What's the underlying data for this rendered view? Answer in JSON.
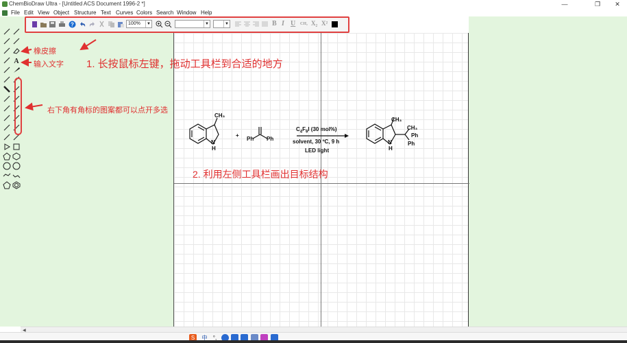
{
  "window": {
    "title": "ChemBioDraw Ultra - [Untitled ACS Document 1996-2 *]",
    "minimize_glyph": "—",
    "maximize_glyph": "❐",
    "close_glyph": "✕"
  },
  "menu": {
    "items": [
      "File",
      "Edit",
      "View",
      "Object",
      "Structure",
      "Text",
      "Curves",
      "Colors",
      "Search",
      "Window",
      "Help"
    ]
  },
  "toolbar": {
    "zoom_value": "100%",
    "font_value": "",
    "size_value": "",
    "bold_label": "B",
    "italic_label": "I",
    "underline_label": "U",
    "formula_label": "CH₂",
    "subscript_label": "X₂",
    "superscript_label": "X²"
  },
  "annotations": {
    "eraser": "橡皮擦",
    "text_input": "输入文字",
    "drag_toolbar": "1. 长按鼠标左键，拖动工具栏到合适的地方",
    "corner_tools": "右下角有角标的图案都可以点开多选",
    "draw_structure": "2. 利用左侧工具栏画出目标结构"
  },
  "reaction": {
    "reactant1_ch3": "CH₃",
    "reactant1_nh_n": "N",
    "reactant1_nh_h": "H",
    "plus": "+",
    "reactant2_ph_left": "Ph",
    "reactant2_ph_right": "Ph",
    "condition1_html_parts": [
      "C",
      "4",
      "F",
      "9",
      "I (30 mol%)"
    ],
    "condition2": "solvent, 30 ºC, 9 h",
    "condition3": "LED light",
    "product_ch3_top": "CH₃",
    "product_ch3_right": "CH₃",
    "product_ph1": "Ph",
    "product_ph2": "Ph",
    "product_n": "N",
    "product_h": "H"
  },
  "colors": {
    "annotation_red": "#e03030",
    "doc_green": "#e3f5de"
  },
  "taskbar": {
    "ime_label": "中"
  }
}
